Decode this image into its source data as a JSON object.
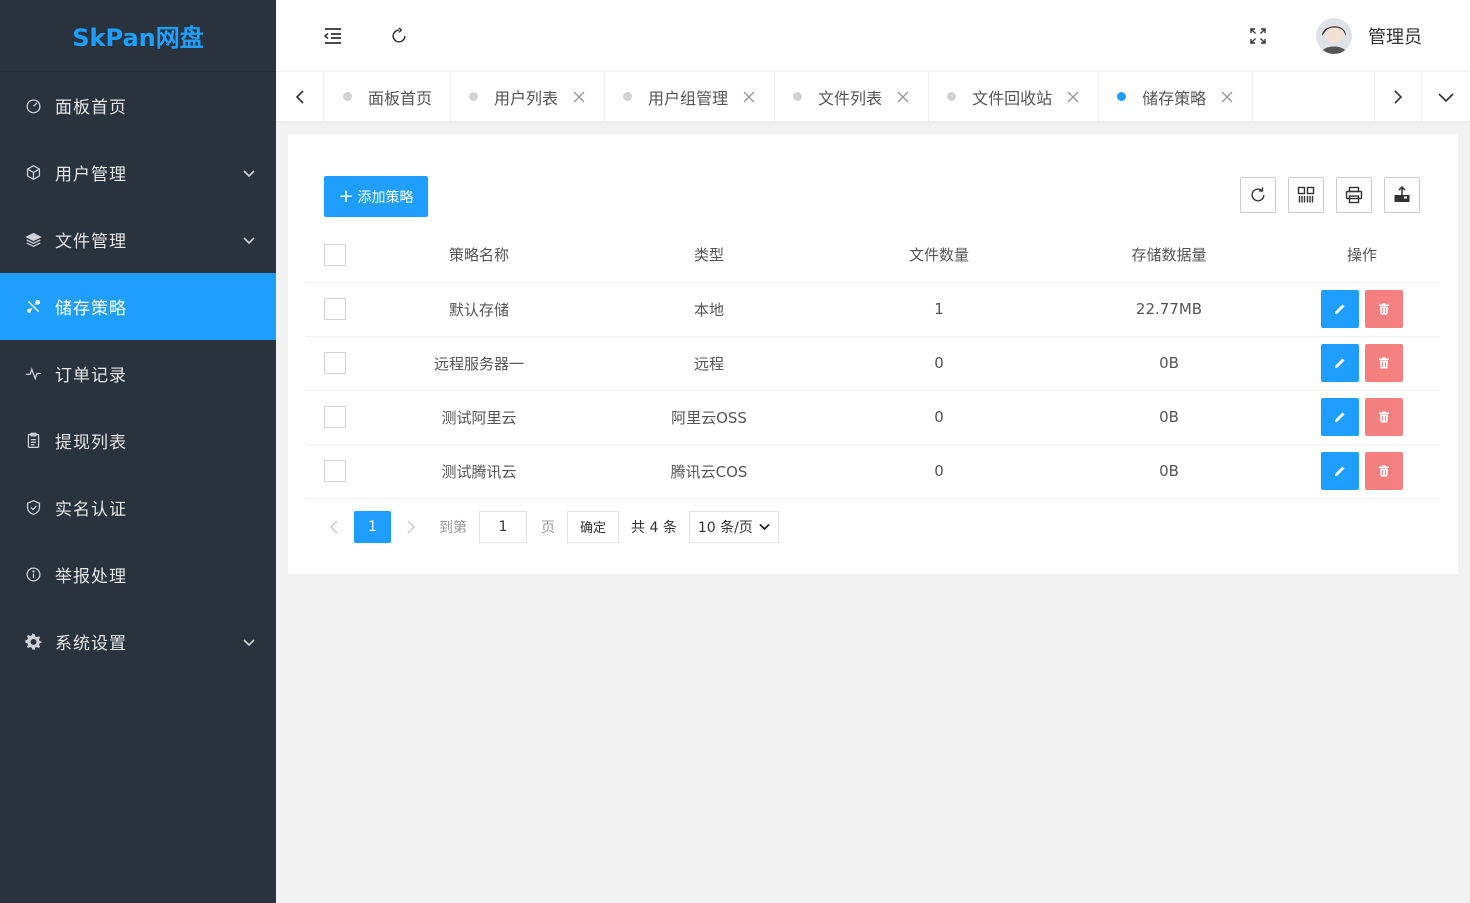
{
  "app": {
    "title": "SkPan网盘"
  },
  "sidebar": {
    "items": [
      {
        "label": "面板首页",
        "icon": "dashboard-icon",
        "has_children": false,
        "active": false
      },
      {
        "label": "用户管理",
        "icon": "cube-icon",
        "has_children": true,
        "active": false
      },
      {
        "label": "文件管理",
        "icon": "layers-icon",
        "has_children": true,
        "active": false
      },
      {
        "label": "储存策略",
        "icon": "tools-icon",
        "has_children": false,
        "active": true
      },
      {
        "label": "订单记录",
        "icon": "pulse-icon",
        "has_children": false,
        "active": false
      },
      {
        "label": "提现列表",
        "icon": "clipboard-icon",
        "has_children": false,
        "active": false
      },
      {
        "label": "实名认证",
        "icon": "shield-check-icon",
        "has_children": false,
        "active": false
      },
      {
        "label": "举报处理",
        "icon": "info-circle-icon",
        "has_children": false,
        "active": false
      },
      {
        "label": "系统设置",
        "icon": "gear-icon",
        "has_children": true,
        "active": false
      }
    ]
  },
  "header": {
    "username": "管理员"
  },
  "tabs": [
    {
      "label": "面板首页",
      "closable": false,
      "active": false
    },
    {
      "label": "用户列表",
      "closable": true,
      "active": false
    },
    {
      "label": "用户组管理",
      "closable": true,
      "active": false
    },
    {
      "label": "文件列表",
      "closable": true,
      "active": false
    },
    {
      "label": "文件回收站",
      "closable": true,
      "active": false
    },
    {
      "label": "储存策略",
      "closable": true,
      "active": true
    }
  ],
  "toolbar": {
    "add_label": "添加策略"
  },
  "table": {
    "columns": [
      "策略名称",
      "类型",
      "文件数量",
      "存储数据量",
      "操作"
    ],
    "rows": [
      {
        "name": "默认存储",
        "type": "本地",
        "count": "1",
        "size": "22.77MB"
      },
      {
        "name": "远程服务器一",
        "type": "远程",
        "count": "0",
        "size": "0B"
      },
      {
        "name": "测试阿里云",
        "type": "阿里云OSS",
        "count": "0",
        "size": "0B"
      },
      {
        "name": "测试腾讯云",
        "type": "腾讯云COS",
        "count": "0",
        "size": "0B"
      }
    ]
  },
  "pagination": {
    "current": "1",
    "goto_label": "到第",
    "goto_value": "1",
    "page_label": "页",
    "confirm_label": "确定",
    "total_label": "共 4 条",
    "limit_label": "10 条/页"
  },
  "colors": {
    "sidebar_bg": "#28333e",
    "accent": "#1e9fff",
    "danger": "#f36b6b"
  }
}
